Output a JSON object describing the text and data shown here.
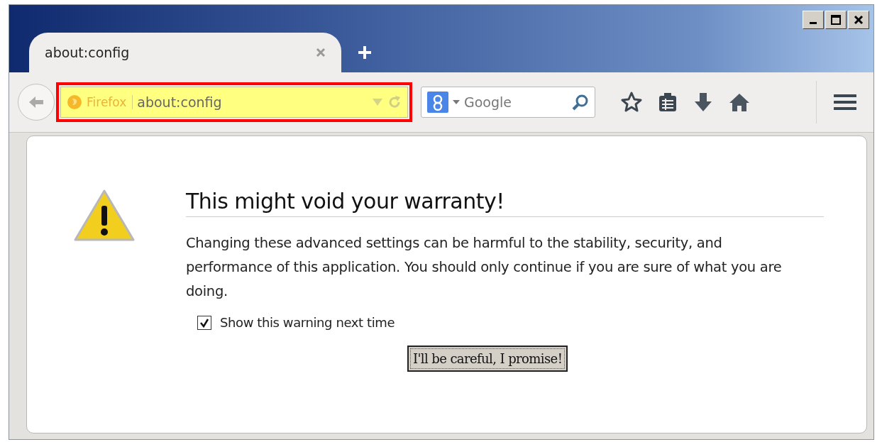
{
  "tabs": [
    {
      "title": "about:config",
      "selected": true
    }
  ],
  "url_bar": {
    "identity": "Firefox",
    "value": "about:config",
    "highlighted": true
  },
  "search": {
    "placeholder": "Google"
  },
  "page": {
    "heading": "This might void your warranty!",
    "message": "Changing these advanced settings can be harmful to the stability, security, and performance of this application. You should only continue if you are sure of what you are doing.",
    "checkbox": {
      "label": "Show this warning next time",
      "checked": true
    },
    "button": "I'll be careful, I promise!"
  }
}
